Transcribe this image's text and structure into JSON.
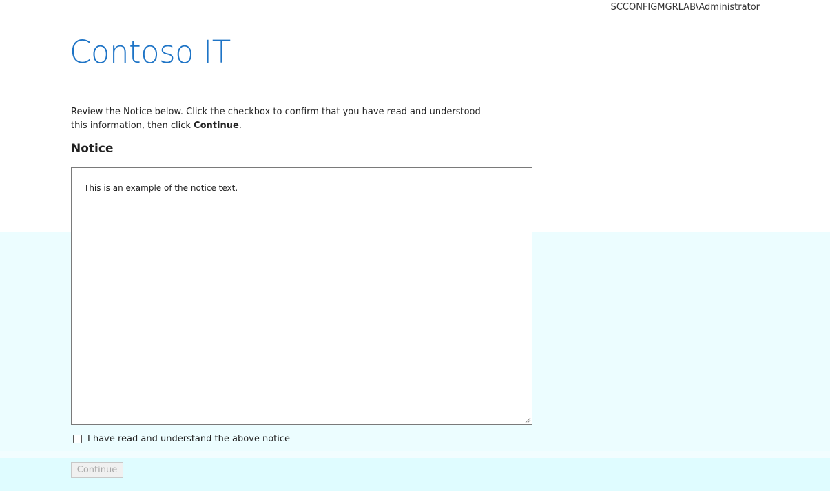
{
  "header": {
    "user": "SCCONFIGMGRLAB\\Administrator",
    "brand": "Contoso IT"
  },
  "instructions": {
    "text_before": "Review the Notice below. Click the checkbox to confirm that you have read and understood this information, then click ",
    "emphasis": "Continue",
    "text_after": "."
  },
  "notice": {
    "heading": "Notice",
    "body": "This is an example of the notice text."
  },
  "confirm": {
    "label": "I have read and understand the above notice",
    "checked": false
  },
  "actions": {
    "continue_label": "Continue",
    "continue_enabled": false
  },
  "colors": {
    "brand": "#1e74c6",
    "header_rule": "#4ba3d3",
    "background_tint": "#ecfdff"
  }
}
